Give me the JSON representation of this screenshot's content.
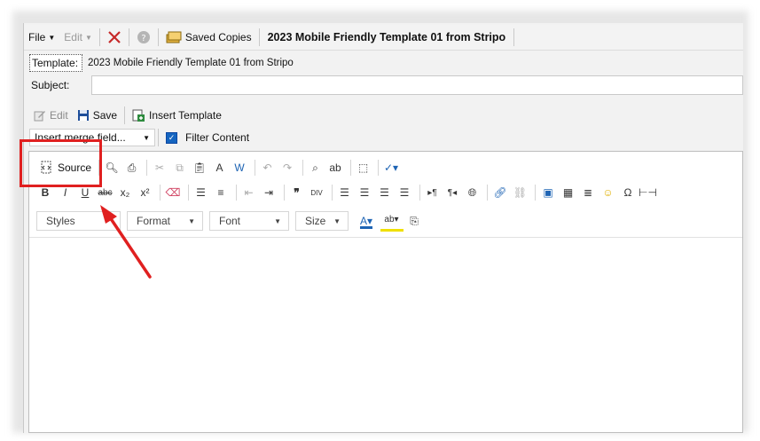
{
  "menubar": {
    "file_label": "File",
    "edit_label": "Edit",
    "saved_copies_label": "Saved Copies",
    "document_title": "2023 Mobile Friendly Template 01 from Stripo"
  },
  "template_field": {
    "label": "Template:",
    "value": "2023 Mobile Friendly Template 01 from Stripo"
  },
  "subject_field": {
    "label": "Subject:",
    "value": ""
  },
  "edit_toolbar": {
    "edit_label": "Edit",
    "save_label": "Save",
    "insert_template_label": "Insert Template"
  },
  "merge_bar": {
    "merge_select_value": "Insert merge field...",
    "filter_content_label": "Filter Content",
    "filter_checked": true
  },
  "editor_toolbar": {
    "source_label": "Source",
    "styles_label": "Styles",
    "format_label": "Format",
    "font_label": "Font",
    "size_label": "Size",
    "icons_row1": [
      "source-icon",
      "preview-icon",
      "print-icon",
      "cut-icon",
      "copy-icon",
      "paste-icon",
      "paste-text-icon",
      "paste-word-icon",
      "undo-icon",
      "redo-icon",
      "find-icon",
      "replace-icon",
      "select-all-icon",
      "spellcheck-icon"
    ],
    "icons_row2": [
      "bold-icon",
      "italic-icon",
      "underline-icon",
      "strikethrough-icon",
      "subscript-icon",
      "superscript-icon",
      "remove-format-icon",
      "numbered-list-icon",
      "bulleted-list-icon",
      "outdent-icon",
      "indent-icon",
      "blockquote-icon",
      "div-icon",
      "align-left-icon",
      "align-center-icon",
      "align-right-icon",
      "justify-icon",
      "ltr-icon",
      "rtl-icon",
      "language-icon",
      "link-icon",
      "unlink-icon",
      "anchor-icon",
      "table-icon",
      "image-icon",
      "smiley-icon",
      "special-char-icon",
      "horizontal-rule-icon"
    ]
  },
  "colors": {
    "annotation_red": "#e02020",
    "accent_blue": "#1e64b4"
  }
}
